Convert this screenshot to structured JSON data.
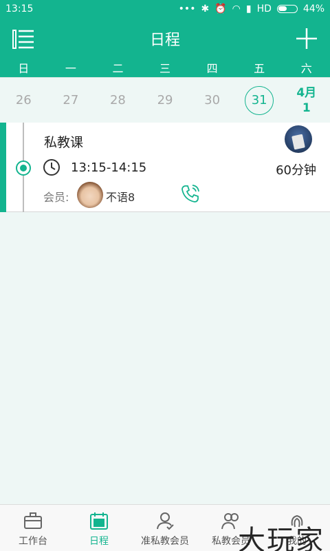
{
  "status_bar": {
    "time": "13:15",
    "network": "HD",
    "battery": "44%"
  },
  "header": {
    "title": "日程"
  },
  "weekdays": [
    "日",
    "一",
    "二",
    "三",
    "四",
    "五",
    "六"
  ],
  "dates": {
    "d26": "26",
    "d27": "27",
    "d28": "28",
    "d29": "29",
    "d30": "30",
    "d31": "31",
    "next_month": "4月",
    "next_day": "1"
  },
  "lesson": {
    "course": "私教课",
    "time": "13:15-14:15",
    "duration": "60分钟",
    "member_label": "会员:",
    "member_name": "不语8"
  },
  "tabs": [
    "工作台",
    "日程",
    "准私教会员",
    "私教会员",
    "我的"
  ],
  "watermark": "大玩家",
  "colors": {
    "accent": "#13b48f",
    "background": "#eef7f5"
  }
}
